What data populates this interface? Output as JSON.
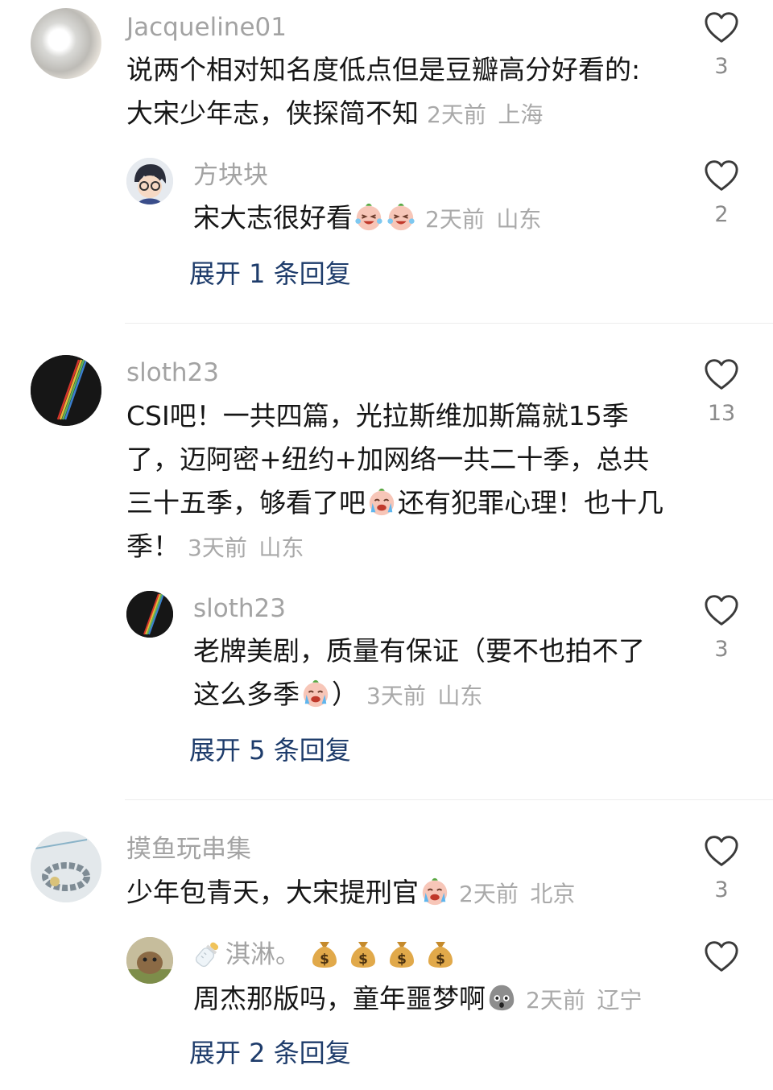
{
  "threads": [
    {
      "user": "Jacqueline01",
      "text": "说两个相对知名度低点但是豆瓣高分好看的:大宋少年志，侠探简不知",
      "time": "2天前",
      "location": "上海",
      "likes": "3",
      "reply": {
        "user": "方块块",
        "text": "宋大志很好看",
        "emojis": [
          "laugh-cry-emoji",
          "laugh-cry-emoji"
        ],
        "time": "2天前",
        "location": "山东",
        "likes": "2"
      },
      "expand": "展开 1 条回复"
    },
    {
      "user": "sloth23",
      "text_a": "CSI吧！一共四篇，光拉斯维加斯篇就15季了，迈阿密+纽约+加网络一共二十季，总共三十五季，够看了吧",
      "text_b": "还有犯罪心理！也十几季！",
      "time": "3天前",
      "location": "山东",
      "likes": "13",
      "reply": {
        "user": "sloth23",
        "text_a": "老牌美剧，质量有保证（要不也拍不了这么多季",
        "text_b": "）",
        "time": "3天前",
        "location": "山东",
        "likes": "3"
      },
      "expand": "展开 5 条回复"
    },
    {
      "user": "摸鱼玩串集",
      "text": "少年包青天，大宋提刑官",
      "time": "2天前",
      "location": "北京",
      "likes": "3",
      "reply": {
        "user": "淇淋。",
        "text": "周杰那版吗，童年噩梦啊",
        "time": "2天前",
        "location": "辽宁",
        "likes": ""
      },
      "expand": "展开 2 条回复"
    }
  ],
  "colors": {
    "username": "#a3a3a3",
    "meta": "#a9a9a9",
    "expand_link": "#1e3c6b",
    "heart_stroke": "#3a3a3a"
  }
}
